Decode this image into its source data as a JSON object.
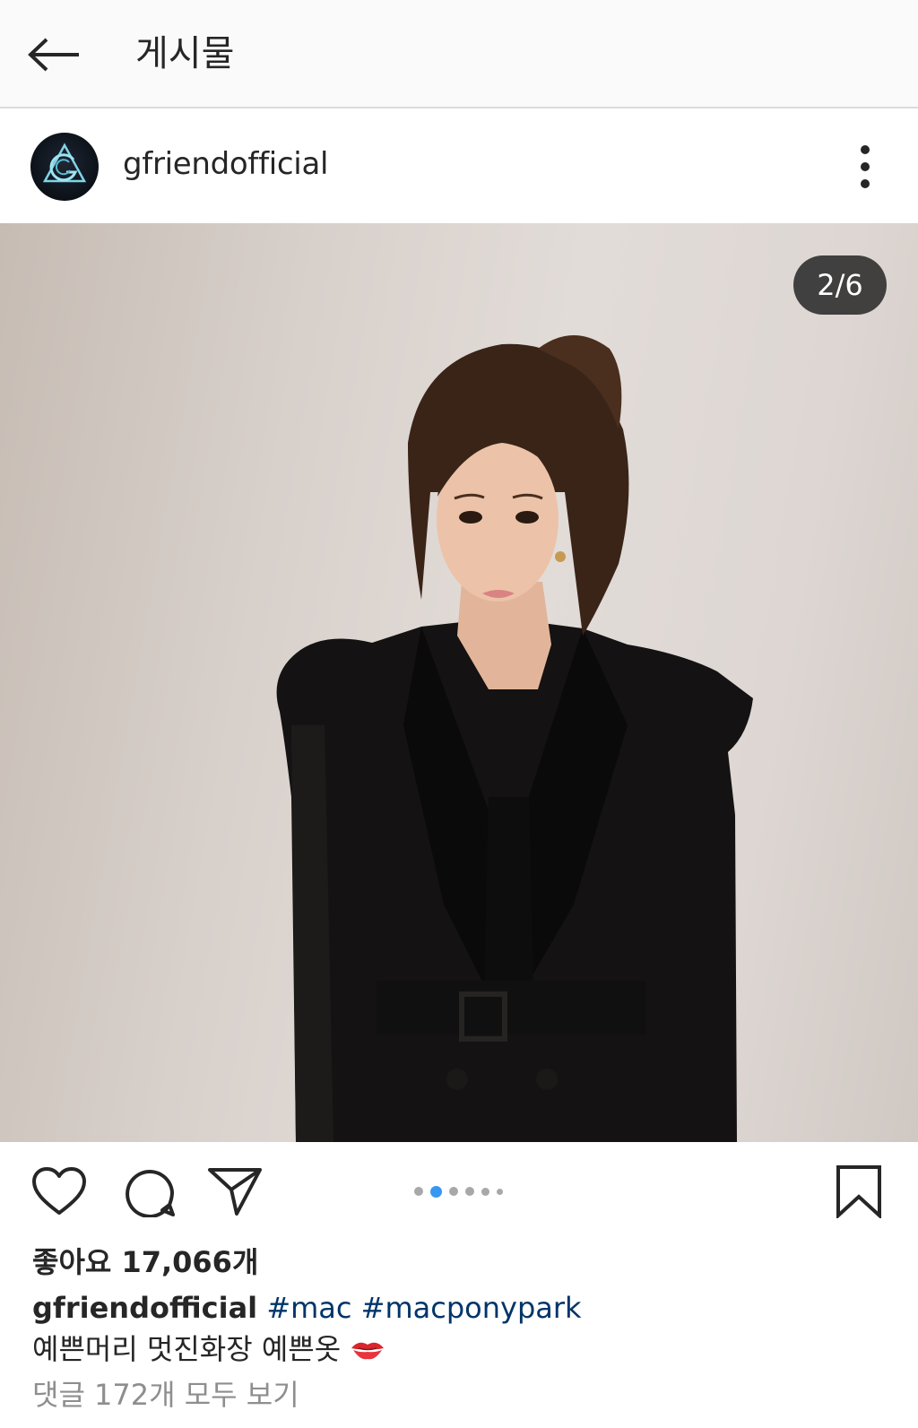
{
  "topbar": {
    "title": "게시물",
    "back_icon": "arrow-left-icon"
  },
  "post": {
    "username": "gfriendofficial",
    "avatar_icon": "gfriend-logo",
    "more_icon": "more-vertical-icon",
    "image_counter": "2/6",
    "image_description_hidden": true,
    "carousel": {
      "count": 6,
      "active_index": 1,
      "accent": "#3897f0"
    }
  },
  "actions": {
    "like_icon": "heart-icon",
    "comment_icon": "comment-icon",
    "share_icon": "send-icon",
    "save_icon": "bookmark-icon"
  },
  "likes": "좋아요 17,066개",
  "caption": {
    "username": "gfriendofficial",
    "tags": [
      "#mac",
      "#macponypark"
    ],
    "text": "예쁜머리 멋진화장 예쁜옷",
    "emoji": "kiss-mark-icon"
  },
  "view_comments": "댓글 172개 모두 보기"
}
